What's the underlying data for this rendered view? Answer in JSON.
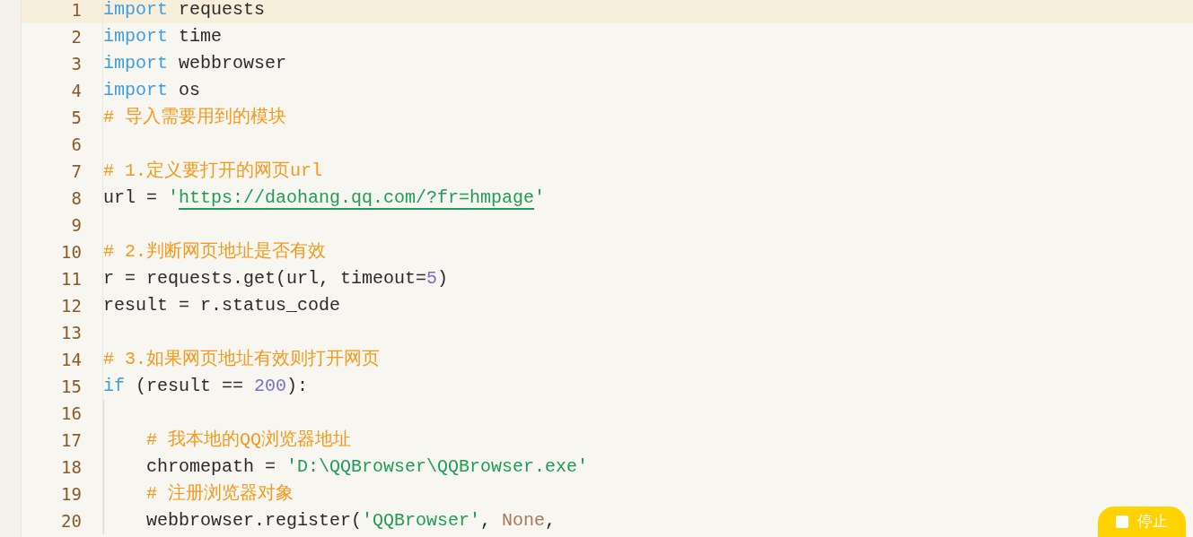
{
  "editor": {
    "lines": [
      {
        "number": "1",
        "current": true,
        "tokens": [
          {
            "kind": "keyword",
            "text": "import"
          },
          {
            "kind": "plain",
            "text": " requests"
          }
        ]
      },
      {
        "number": "2",
        "current": false,
        "tokens": [
          {
            "kind": "keyword",
            "text": "import"
          },
          {
            "kind": "plain",
            "text": " time"
          }
        ]
      },
      {
        "number": "3",
        "current": false,
        "tokens": [
          {
            "kind": "keyword",
            "text": "import"
          },
          {
            "kind": "plain",
            "text": " webbrowser"
          }
        ]
      },
      {
        "number": "4",
        "current": false,
        "tokens": [
          {
            "kind": "keyword",
            "text": "import"
          },
          {
            "kind": "plain",
            "text": " os"
          }
        ]
      },
      {
        "number": "5",
        "current": false,
        "tokens": [
          {
            "kind": "comment",
            "text": "# 导入需要用到的模块"
          }
        ]
      },
      {
        "number": "6",
        "current": false
      },
      {
        "number": "7",
        "current": false,
        "tokens": [
          {
            "kind": "comment",
            "text": "# 1.定义要打开的网页url"
          }
        ]
      },
      {
        "number": "8",
        "current": false,
        "tokens": [
          {
            "kind": "plain",
            "text": "url = "
          },
          {
            "kind": "string",
            "text": "'"
          },
          {
            "kind": "link",
            "text": "https://daohang.qq.com/?fr=hmpage"
          },
          {
            "kind": "string",
            "text": "'"
          }
        ]
      },
      {
        "number": "9",
        "current": false
      },
      {
        "number": "10",
        "current": false,
        "tokens": [
          {
            "kind": "comment",
            "text": "# 2.判断网页地址是否有效"
          }
        ]
      },
      {
        "number": "11",
        "current": false,
        "tokens": [
          {
            "kind": "plain",
            "text": "r = requests.get(url, timeout="
          },
          {
            "kind": "number",
            "text": "5"
          },
          {
            "kind": "plain",
            "text": ")"
          }
        ]
      },
      {
        "number": "12",
        "current": false,
        "tokens": [
          {
            "kind": "plain",
            "text": "result = r.status_code"
          }
        ]
      },
      {
        "number": "13",
        "current": false
      },
      {
        "number": "14",
        "current": false,
        "tokens": [
          {
            "kind": "comment",
            "text": "# 3.如果网页地址有效则打开网页"
          }
        ]
      },
      {
        "number": "15",
        "current": false,
        "tokens": [
          {
            "kind": "keyword",
            "text": "if"
          },
          {
            "kind": "plain",
            "text": " (result == "
          },
          {
            "kind": "number",
            "text": "200"
          },
          {
            "kind": "plain",
            "text": "):"
          }
        ],
        "children": [
          {
            "number": "16",
            "current": false
          },
          {
            "number": "17",
            "current": false,
            "tokens": [
              {
                "kind": "comment",
                "text": "# 我本地的QQ浏览器地址"
              }
            ]
          },
          {
            "number": "18",
            "current": false,
            "tokens": [
              {
                "kind": "plain",
                "text": "chromepath = "
              },
              {
                "kind": "string",
                "text": "'D:\\QQBrowser\\QQBrowser.exe'"
              }
            ]
          },
          {
            "number": "19",
            "current": false,
            "tokens": [
              {
                "kind": "comment",
                "text": "# 注册浏览器对象"
              }
            ]
          },
          {
            "number": "20",
            "current": false,
            "tokens": [
              {
                "kind": "plain",
                "text": "webbrowser.register("
              },
              {
                "kind": "string",
                "text": "'QQBrowser'"
              },
              {
                "kind": "plain",
                "text": ", "
              },
              {
                "kind": "constant",
                "text": "None"
              },
              {
                "kind": "plain",
                "text": ","
              }
            ]
          }
        ]
      }
    ]
  },
  "stop_button": {
    "label": "停止"
  }
}
